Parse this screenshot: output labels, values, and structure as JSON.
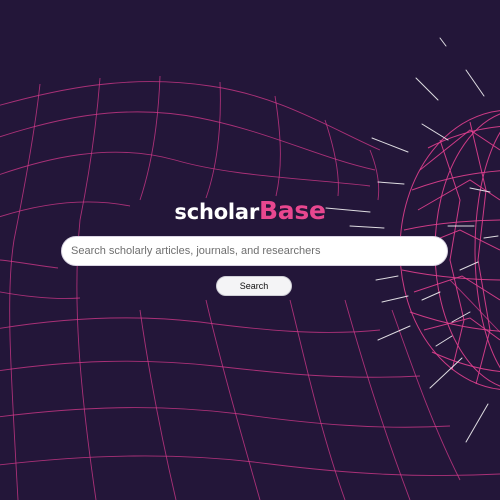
{
  "brand": {
    "name_part_1": "scholar",
    "name_part_2": "Base",
    "accent_color": "#e8478f",
    "background_color": "#231639"
  },
  "search": {
    "placeholder": "Search scholarly articles, journals, and researchers",
    "value": "",
    "button_label": "Search"
  }
}
